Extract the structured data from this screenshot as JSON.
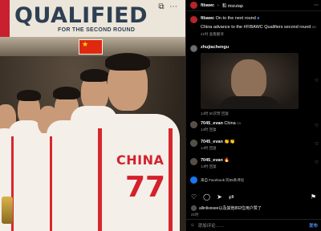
{
  "poster": {
    "title": "QUALIFIED",
    "subtitle": "FOR THE SECOND ROUND",
    "jersey_name": "CHINA",
    "jersey_number": "77"
  },
  "header": {
    "account": "fibawc",
    "separator": "•",
    "collab": "和 mizutap"
  },
  "caption": {
    "author": "fibawc",
    "text_line1": "On to the next round",
    "text_line2": "China advance to the #FIBAWC Qualifiers second round",
    "flag_suffix": "cn",
    "meta": "21时  查看翻译"
  },
  "comments": [
    {
      "user": "zhujiachengu",
      "text": "",
      "meta": "14时  50次赞  回复"
    },
    {
      "user": "7045_evan",
      "text": "China",
      "suffix": "cn",
      "meta": "14时  回复"
    },
    {
      "user": "7045_evan",
      "text": "👏👏",
      "meta": "14时  回复"
    },
    {
      "user": "7045_evan",
      "text": "🔥",
      "meta": "14时  回复"
    }
  ],
  "facebook_note": "来自 Facebook 的35条评论",
  "likes_text": "allinlivesee以及其他892位用户赞了",
  "time_text": "21时",
  "input": {
    "placeholder": "添加评论……",
    "post_label": "发布"
  },
  "icons": [
    "heart-icon",
    "comment-icon",
    "share-icon",
    "save-icon",
    "more-icon",
    "emoji-icon"
  ]
}
